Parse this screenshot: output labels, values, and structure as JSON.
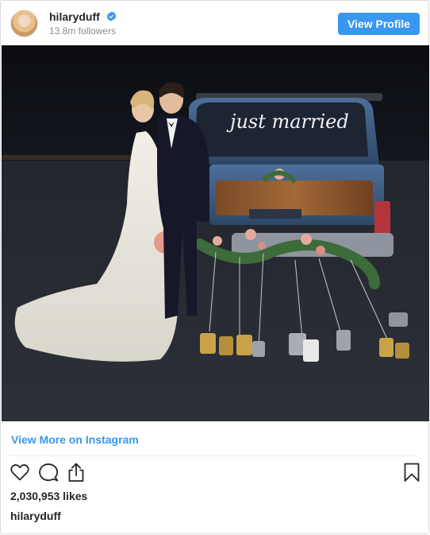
{
  "header": {
    "username": "hilaryduff",
    "followers": "13.8m followers",
    "view_profile_label": "View Profile"
  },
  "post": {
    "photo_text": "just married",
    "view_more_label": "View More on Instagram",
    "likes": "2,030,953 likes",
    "caption_user": "hilaryduff"
  },
  "icons": {
    "verified": "verified-badge-icon",
    "like": "heart-icon",
    "comment": "comment-icon",
    "share": "share-icon",
    "save": "bookmark-icon"
  },
  "colors": {
    "accent": "#3897f0",
    "text": "#262626",
    "muted": "#8e8e8e",
    "border": "#dbdbdb"
  }
}
